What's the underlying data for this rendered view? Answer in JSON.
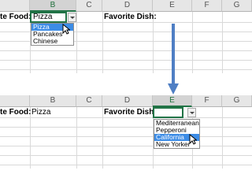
{
  "columns": [
    "B",
    "C",
    "D",
    "E",
    "F",
    "G"
  ],
  "top": {
    "label_food": "te Food:",
    "label_dish": "Favorite Dish:",
    "selected_food": "Pizza",
    "food_options": [
      "Pizza",
      "Pancakes",
      "Chinese"
    ],
    "highlighted_index": 0
  },
  "bottom": {
    "label_food": "te Food:",
    "food_value": "Pizza",
    "label_dish": "Favorite Dish:",
    "dish_options": [
      "Mediterranean",
      "Pepperoni",
      "California",
      "New Yorker"
    ],
    "highlighted_index": 2
  },
  "colors": {
    "accent_green": "#217346",
    "highlight_blue": "#3c8ce6",
    "arrow_blue": "#4f7fc4"
  }
}
